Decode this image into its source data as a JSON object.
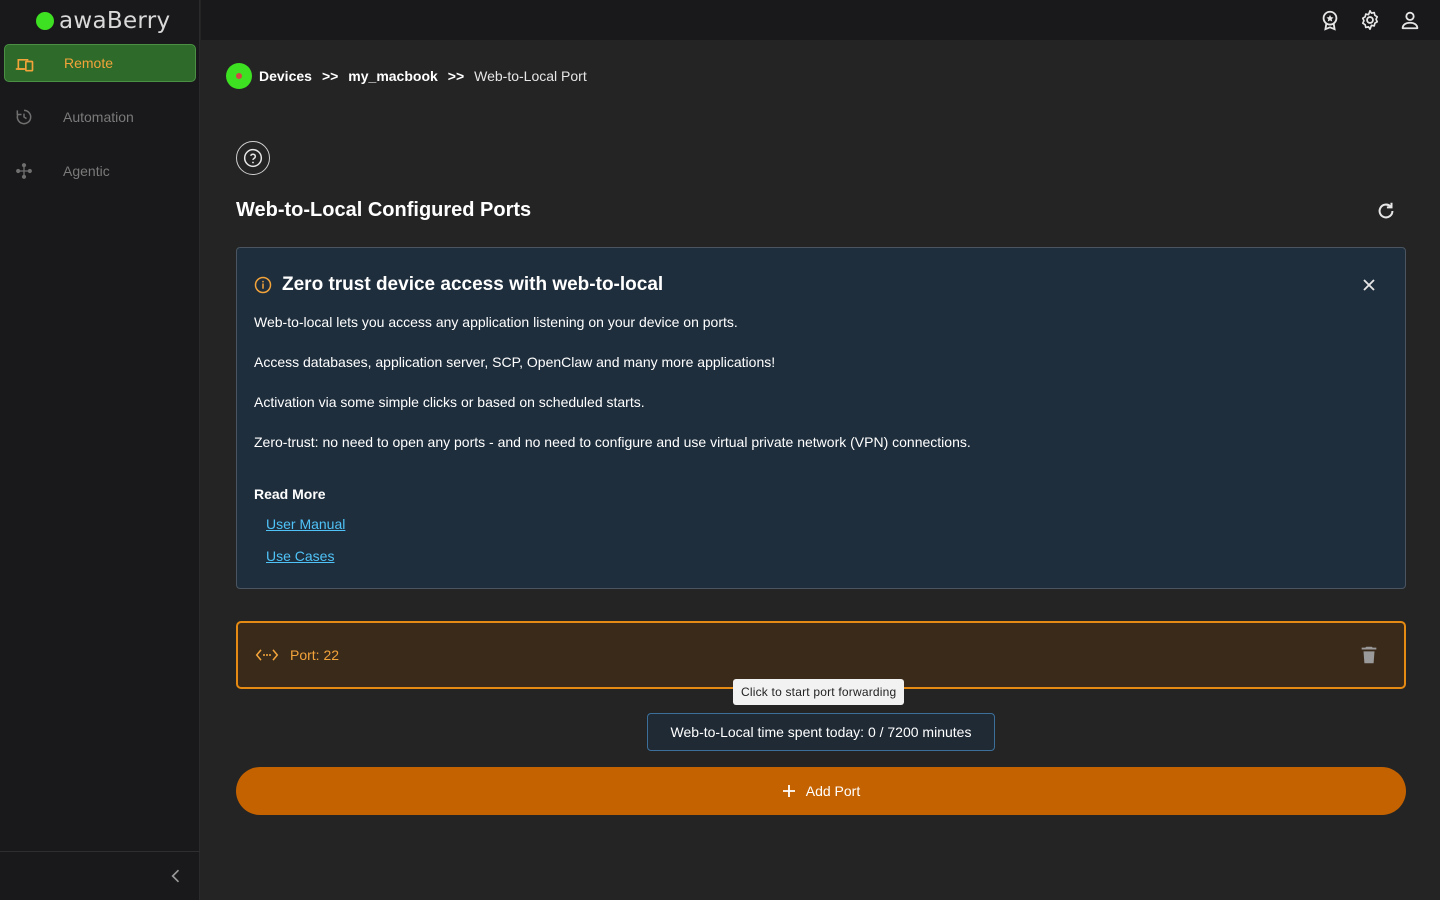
{
  "app": {
    "name": "awaBerry",
    "brand_color": "#3ee022",
    "accent_color": "#c46200"
  },
  "sidebar": {
    "items": [
      {
        "label": "Remote",
        "icon": "devices-icon",
        "active": true
      },
      {
        "label": "Automation",
        "icon": "automation-icon",
        "active": false
      },
      {
        "label": "Agentic",
        "icon": "agentic-icon",
        "active": false
      }
    ],
    "collapse_icon": "chevron-left-icon"
  },
  "topbar": {
    "icons": [
      "award-icon",
      "gear-icon",
      "user-icon"
    ]
  },
  "breadcrumb": {
    "items": [
      "Devices",
      "my_macbook"
    ],
    "separator": ">>",
    "current": "Web-to-Local Port"
  },
  "page": {
    "title": "Web-to-Local Configured Ports"
  },
  "info": {
    "title": "Zero trust device access with web-to-local",
    "paragraphs": [
      "Web-to-local lets you access any application listening on your device on ports.",
      "Access databases, application server, SCP, OpenClaw and many more applications!",
      "Activation via some simple clicks or based on scheduled starts.",
      "Zero-trust: no need to open any ports - and no need to configure and use virtual private network (VPN) connections."
    ],
    "read_more_label": "Read More",
    "links": [
      "User Manual",
      "Use Cases"
    ]
  },
  "ports": [
    {
      "label": "Port: 22"
    }
  ],
  "tooltip": "Click to start port forwarding",
  "usage": {
    "text": "Web-to-Local time spent today: 0 / 7200 minutes"
  },
  "add_button": {
    "label": "Add Port"
  }
}
